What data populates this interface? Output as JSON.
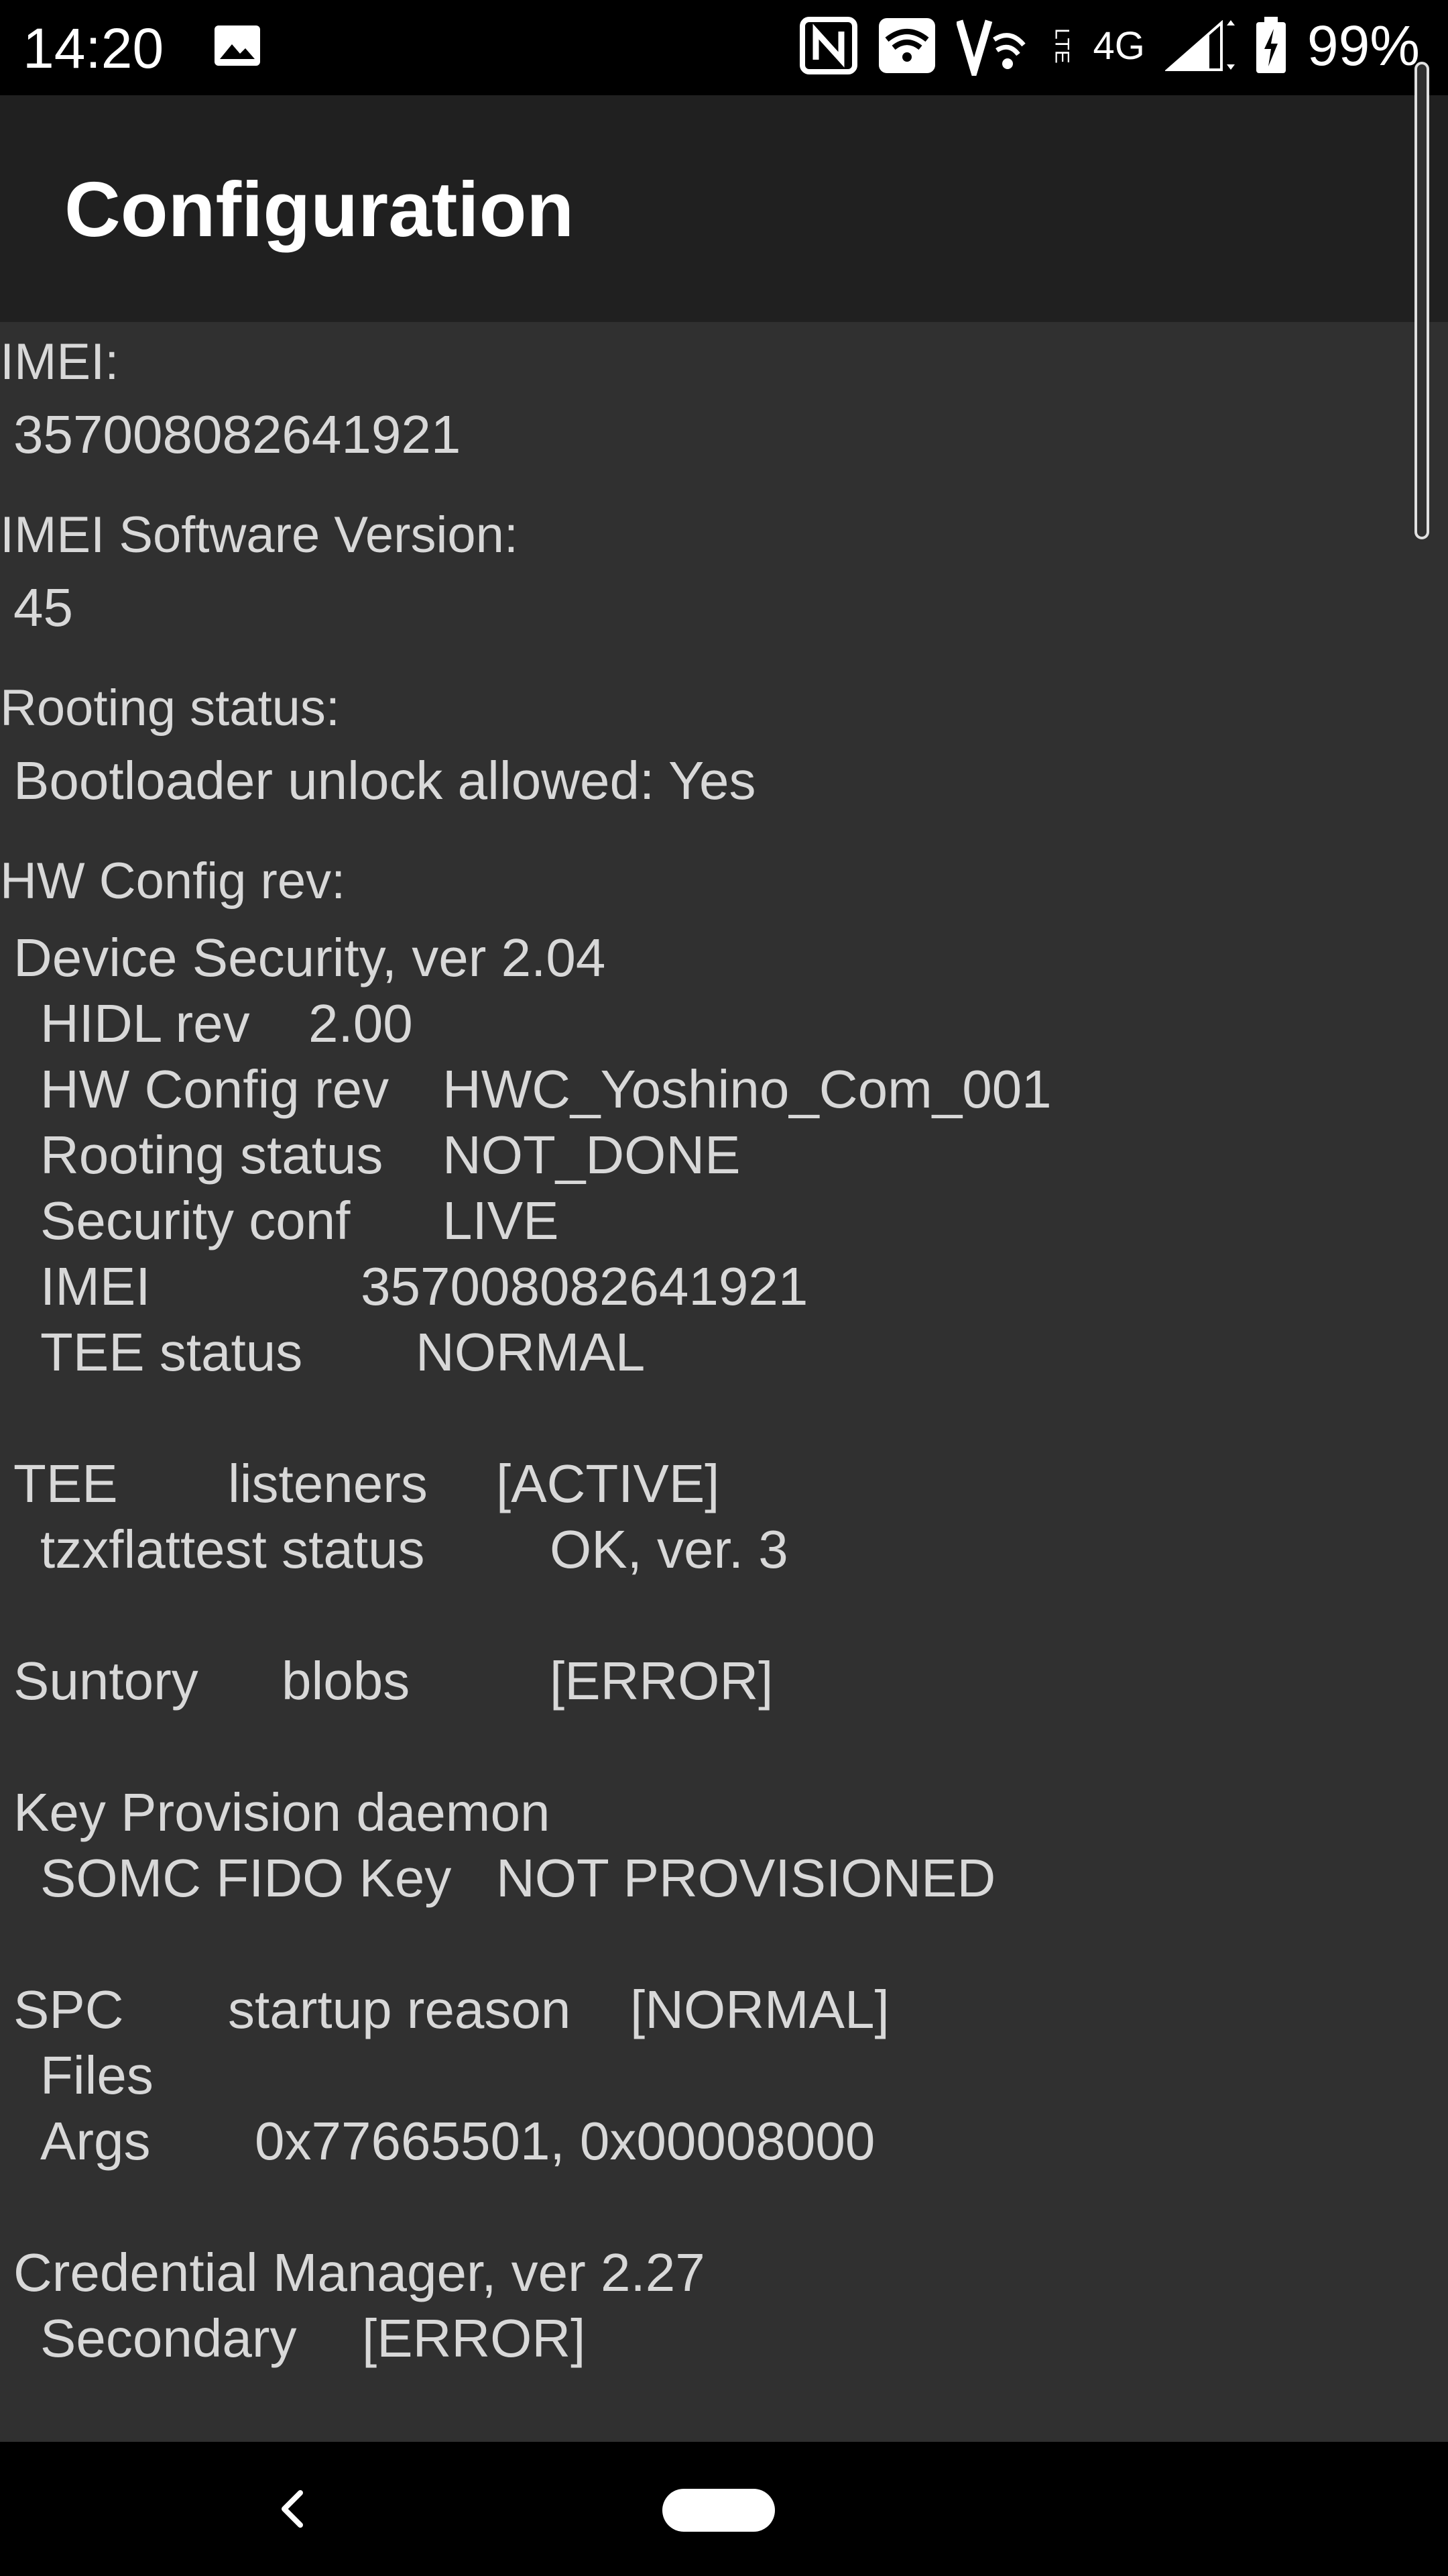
{
  "status_bar": {
    "time": "14:20",
    "network_type": "4G",
    "lte_label": "LTE",
    "battery_percent": "99%",
    "icons": [
      "gallery-icon",
      "nfc-icon",
      "wifi-icon",
      "volte-icon",
      "signal-icon",
      "battery-charging-icon"
    ]
  },
  "app_bar": {
    "title": "Configuration"
  },
  "sections": {
    "imei_label": "IMEI:",
    "imei_value": "357008082641921",
    "imei_sv_label": "IMEI Software Version:",
    "imei_sv_value": "45",
    "rooting_label": "Rooting status:",
    "rooting_value": "Bootloader unlock allowed: Yes",
    "hwconfig_label": "HW Config rev:"
  },
  "hw_config": {
    "device_security": "Device Security, ver 2.04",
    "hidl": {
      "key": "HIDL rev",
      "value": "2.00"
    },
    "hw_config_rev": {
      "key": "HW Config rev",
      "value": "HWC_Yoshino_Com_001"
    },
    "rooting_status": {
      "key": "Rooting status",
      "value": "NOT_DONE"
    },
    "security_conf": {
      "key": "Security conf",
      "value": "LIVE"
    },
    "imei": {
      "key": "IMEI",
      "value": "357008082641921"
    },
    "tee_status": {
      "key": "TEE status",
      "value": "NORMAL"
    },
    "tee": {
      "name": "TEE",
      "sub": "listeners",
      "status": "[ACTIVE]"
    },
    "tzxflattest": {
      "key": "tzxflattest status",
      "value": "OK, ver. 3"
    },
    "suntory": {
      "name": "Suntory",
      "sub": "blobs",
      "status": "[ERROR]"
    },
    "key_provision": "Key Provision daemon",
    "somc_fido": {
      "key": "SOMC FIDO Key",
      "value": "NOT PROVISIONED"
    },
    "spc": {
      "name": "SPC",
      "sub": "startup reason",
      "status": "[NORMAL]"
    },
    "files": "Files",
    "args": {
      "key": "Args",
      "value": "0x77665501, 0x00008000"
    },
    "credential_manager": "Credential Manager, ver 2.27",
    "secondary": {
      "key": "Secondary",
      "value": "[ERROR]"
    }
  },
  "colors": {
    "background": "#303030",
    "app_bar": "#202020",
    "text": "#d8d8d8",
    "bars": "#000000"
  }
}
